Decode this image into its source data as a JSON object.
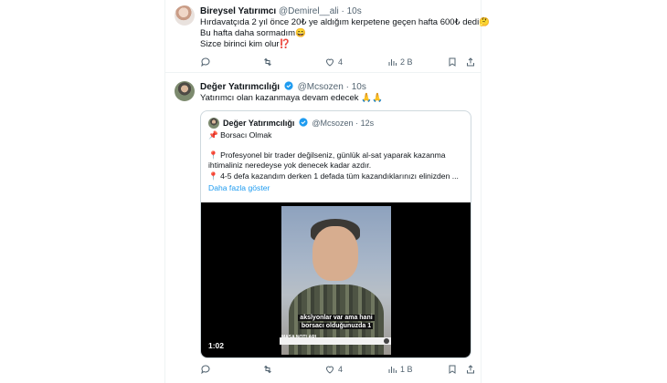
{
  "colors": {
    "accent": "#1d9bf0",
    "muted": "#536471",
    "border": "#cfd9de"
  },
  "tweet1": {
    "name": "Bireysel Yatırımcı",
    "handle": "@Demirel__ali",
    "time": "· 10s",
    "lines": [
      "Hırdavatçıda 2 yıl önce 20₺ ye aldığım kerpetene geçen hafta 600₺ dedi🤔",
      "Bu hafta daha sormadım😄",
      "Sizce birinci kim olur⁉️"
    ],
    "actions": {
      "replies": "",
      "retweets": "",
      "likes": "4",
      "views": "2 B"
    }
  },
  "tweet2": {
    "name": "Değer Yatırımcılığı",
    "handle": "@Mcsozen",
    "time": "· 10s",
    "text": "Yatırımcı olan kazanmaya devam edecek 🙏🙏",
    "quote": {
      "name": "Değer Yatırımcılığı",
      "handle": "@Mcsozen",
      "time": "· 12s",
      "lines": [
        "📌 Borsacı Olmak",
        "📍 Profesyonel bir trader değilseniz, günlük al-sat yaparak kazanma",
        "ihtimaliniz neredeyse yok denecek kadar azdır.",
        "📍 4-5 defa kazandım derken 1 defada tüm kazandıklarınızı elinizden ..."
      ],
      "show_more": "Daha fazla göster",
      "video": {
        "caption_line1": "akslyonlar var ama hani",
        "caption_line2": "borsacı olduğunuzda 1",
        "watermark": "MASA NOTLARI",
        "duration": "1:02"
      }
    },
    "actions": {
      "replies": "",
      "retweets": "",
      "likes": "4",
      "views": "1 B"
    }
  }
}
